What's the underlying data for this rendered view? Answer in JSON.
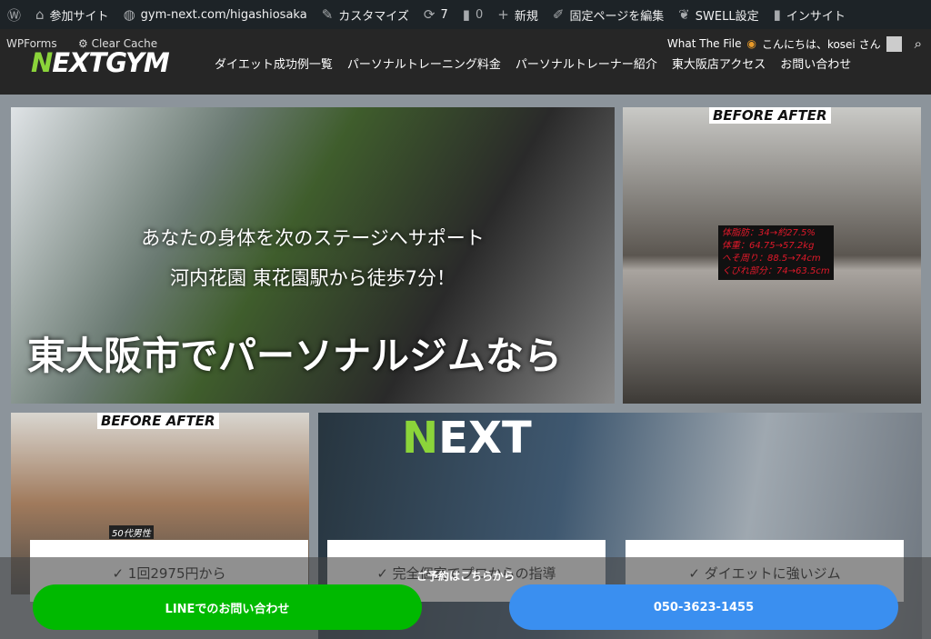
{
  "adminbar": {
    "items": [
      {
        "icon": "wordpress-icon",
        "label": ""
      },
      {
        "icon": "sites-icon",
        "label": "参加サイト"
      },
      {
        "icon": "dashboard-icon",
        "label": "gym-next.com/higashiosaka"
      },
      {
        "icon": "brush-icon",
        "label": "カスタマイズ"
      },
      {
        "icon": "update-icon",
        "label": "7"
      },
      {
        "icon": "comment-icon",
        "label": "0"
      },
      {
        "icon": "plus-icon",
        "label": "新規"
      },
      {
        "icon": "edit-icon",
        "label": "固定ページを編集"
      },
      {
        "icon": "swell-icon",
        "label": "SWELL設定"
      },
      {
        "icon": "chart-icon",
        "label": "インサイト"
      }
    ]
  },
  "header": {
    "wpforms": "WPForms",
    "clear_cache": "Clear Cache",
    "logo_accent": "N",
    "logo_rest": "EXTGYM",
    "what_the_file": "What The File",
    "greeting": "こんにちは、kosei さん",
    "nav": [
      "ダイエット成功例一覧",
      "パーソナルトレーニング料金",
      "パーソナルトレーナー紹介",
      "東大阪店アクセス",
      "お問い合わせ"
    ]
  },
  "hero": {
    "line1": "あなたの身体を次のステージへサポート",
    "line2": "河内花園 東花園駅から徒歩7分！",
    "line3": "東大阪市でパーソナルジムなら"
  },
  "before_after": {
    "label": "BEFORE AFTER",
    "stats": [
      "体脂肪：34→約27.5%",
      "体重：64.75→57.2kg",
      "へそ周り：88.5→74cm",
      "くびれ部分：74→63.5cm"
    ],
    "male_caption": "50代男性"
  },
  "next_banner": {
    "accent": "N",
    "rest": "EXT"
  },
  "features": [
    "✓ 1回2975円から",
    "✓ 完全個室でプロからの指導",
    "✓ ダイエットに強いジム"
  ],
  "cta": {
    "title": "ご予約はこちらから",
    "line_label": "LINEでのお問い合わせ",
    "phone_label": "050-3623-1455"
  },
  "colors": {
    "accent_green": "#8bd43a",
    "line_green": "#00b900",
    "phone_blue": "#3a8ff0"
  }
}
